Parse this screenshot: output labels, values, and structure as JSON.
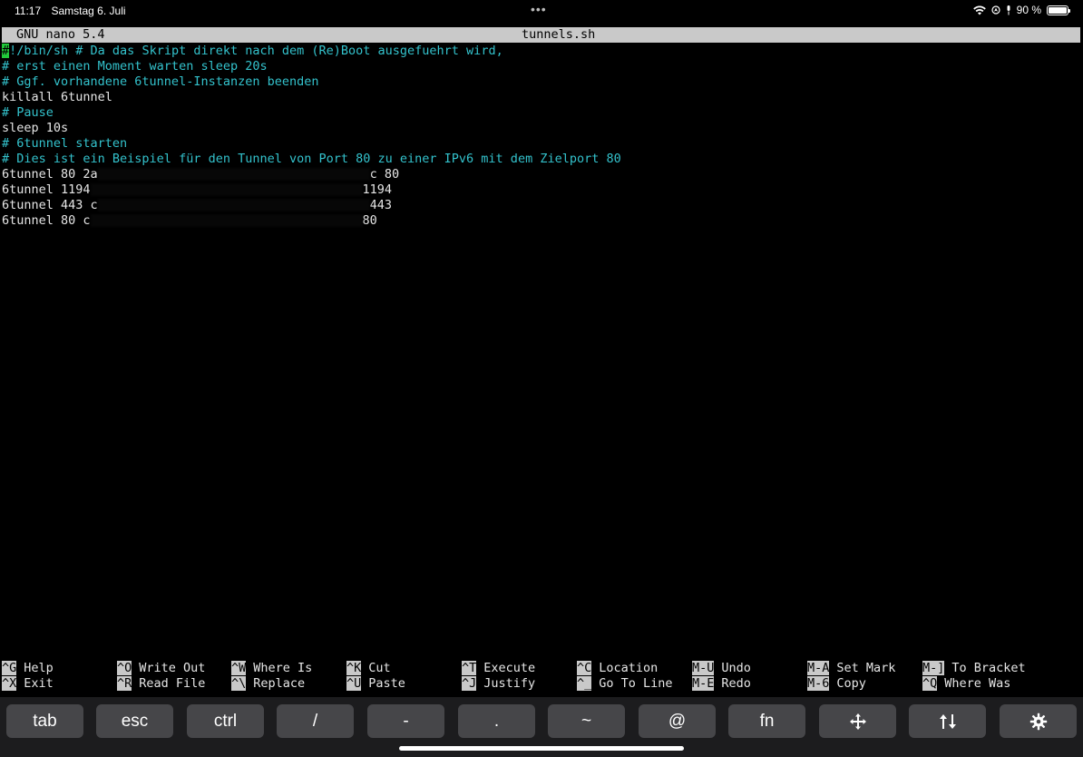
{
  "status_bar": {
    "time": "11:17",
    "date": "Samstag 6. Juli",
    "battery": "90 %",
    "icons": [
      "wifi-icon",
      "location-icon",
      "mic-icon",
      "battery-icon"
    ]
  },
  "window": {
    "dots": "•••"
  },
  "nano": {
    "version": "GNU nano 5.4",
    "filename": "tunnels.sh",
    "lines": [
      {
        "text": "!/bin/sh # Da das Skript direkt nach dem (Re)Boot ausgefuehrt wird,",
        "type": "comment",
        "cursor_char": "#"
      },
      {
        "text": "# erst einen Moment warten sleep 20s",
        "type": "comment"
      },
      {
        "text": "# Ggf. vorhandene 6tunnel-Instanzen beenden",
        "type": "comment"
      },
      {
        "text": "killall 6tunnel",
        "type": "code"
      },
      {
        "text": "# Pause",
        "type": "comment"
      },
      {
        "text": "sleep 10s",
        "type": "code"
      },
      {
        "text": "# 6tunnel starten",
        "type": "comment"
      },
      {
        "text": "# Dies ist ein Beispiel für den Tunnel von Port 80 zu einer IPv6 mit dem Zielport 80",
        "type": "comment"
      },
      {
        "text": "6tunnel 80 2a",
        "type": "code",
        "redacted": true,
        "suffix": "c 80"
      },
      {
        "text": "6tunnel 1194",
        "type": "code",
        "redacted": true,
        "suffix": "1194"
      },
      {
        "text": "6tunnel 443 c",
        "type": "code",
        "redacted": true,
        "suffix": "443"
      },
      {
        "text": "6tunnel 80 c",
        "type": "code",
        "redacted": true,
        "suffix": "80"
      }
    ]
  },
  "shortcuts": [
    {
      "key": "^G",
      "label": "Help"
    },
    {
      "key": "^X",
      "label": "Exit"
    },
    {
      "key": "^O",
      "label": "Write Out"
    },
    {
      "key": "^R",
      "label": "Read File"
    },
    {
      "key": "^W",
      "label": "Where Is"
    },
    {
      "key": "^\\",
      "label": "Replace"
    },
    {
      "key": "^K",
      "label": "Cut"
    },
    {
      "key": "^U",
      "label": "Paste"
    },
    {
      "key": "^T",
      "label": "Execute"
    },
    {
      "key": "^J",
      "label": "Justify"
    },
    {
      "key": "^C",
      "label": "Location"
    },
    {
      "key": "^_",
      "label": "Go To Line"
    },
    {
      "key": "M-U",
      "label": "Undo"
    },
    {
      "key": "M-E",
      "label": "Redo"
    },
    {
      "key": "M-A",
      "label": "Set Mark"
    },
    {
      "key": "M-6",
      "label": "Copy"
    },
    {
      "key": "M-]",
      "label": "To Bracket"
    },
    {
      "key": "^Q",
      "label": "Where Was"
    }
  ],
  "keyboard_row": [
    {
      "label": "tab"
    },
    {
      "label": "esc"
    },
    {
      "label": "ctrl"
    },
    {
      "label": "/"
    },
    {
      "label": "-"
    },
    {
      "label": "."
    },
    {
      "label": "~"
    },
    {
      "label": "@"
    },
    {
      "label": "fn"
    },
    {
      "label": "",
      "icon": "move-arrows-icon"
    },
    {
      "label": "",
      "icon": "up-down-arrows-icon"
    },
    {
      "label": "",
      "icon": "gear-icon"
    }
  ]
}
